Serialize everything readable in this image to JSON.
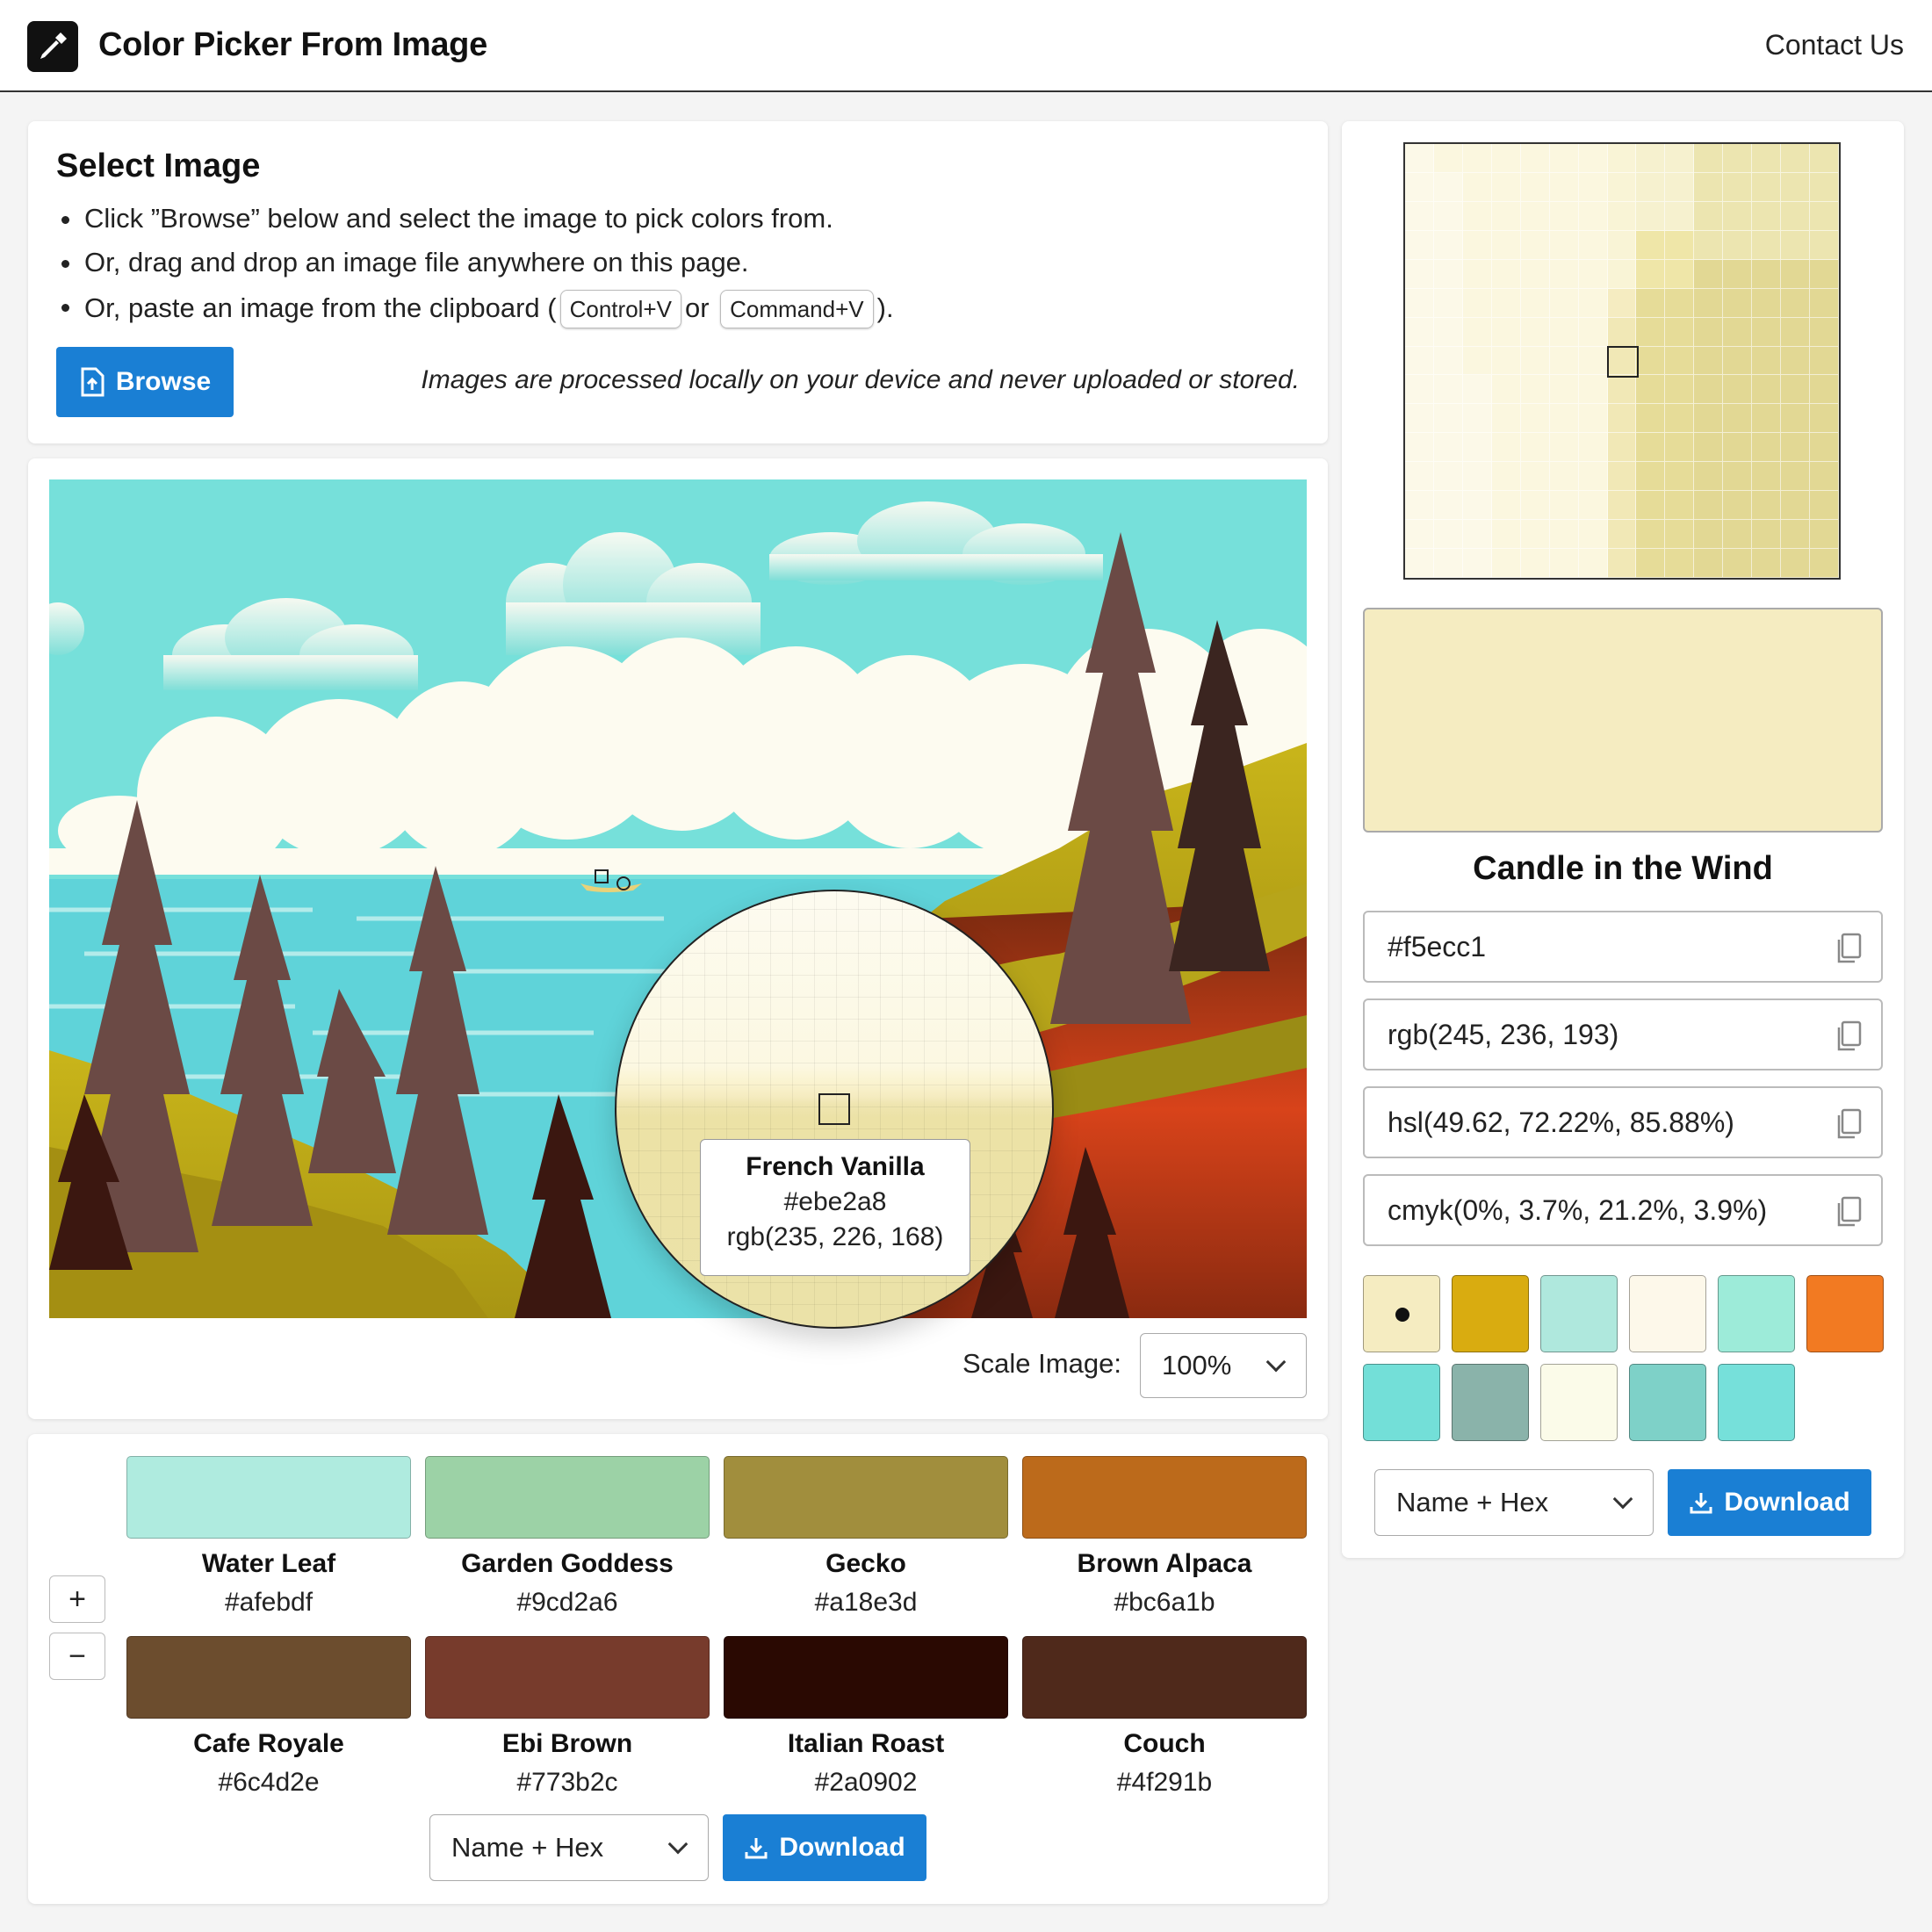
{
  "header": {
    "title": "Color Picker From Image",
    "contact": "Contact Us"
  },
  "select_card": {
    "title": "Select Image",
    "bullet1": "Click ”Browse” below and select the image to pick colors from.",
    "bullet2": "Or, drag and drop an image file anywhere on this page.",
    "bullet3_prefix": "Or, paste an image from the clipboard (",
    "kbd1": "Control+V",
    "bullet3_or": "or",
    "kbd2": "Command+V",
    "bullet3_suffix": ").",
    "browse_label": "Browse",
    "privacy_note": "Images are processed locally on your device and never uploaded or stored."
  },
  "magnifier": {
    "name": "French Vanilla",
    "hex": "#ebe2a8",
    "rgb": "rgb(235, 226, 168)"
  },
  "scale": {
    "label": "Scale Image:",
    "value": "100%"
  },
  "palette": {
    "items": [
      {
        "name": "Water Leaf",
        "hex": "#afebdf"
      },
      {
        "name": "Garden Goddess",
        "hex": "#9cd2a6"
      },
      {
        "name": "Gecko",
        "hex": "#a18e3d"
      },
      {
        "name": "Brown Alpaca",
        "hex": "#bc6a1b"
      },
      {
        "name": "Cafe Royale",
        "hex": "#6c4d2e"
      },
      {
        "name": "Ebi Brown",
        "hex": "#773b2c"
      },
      {
        "name": "Italian Roast",
        "hex": "#2a0902"
      },
      {
        "name": "Couch",
        "hex": "#4f291b"
      }
    ],
    "zoom_in": "+",
    "zoom_out": "−",
    "format_select": "Name + Hex",
    "download_label": "Download"
  },
  "picked": {
    "name": "Candle in the Wind",
    "hex": "#f5ecc1",
    "rgb": "rgb(245, 236, 193)",
    "hsl": "hsl(49.62, 72.22%, 85.88%)",
    "cmyk": "cmyk(0%, 3.7%, 21.2%, 3.9%)",
    "swatch_color": "#f5ecc1"
  },
  "history": {
    "colors": [
      "#f5ecc1",
      "#d9ac10",
      "#afe8dd",
      "#fdf8ea",
      "#9debd9",
      "#f27a22",
      "#73dfd8",
      "#8ab3aa",
      "#fbfbe9",
      "#7ed1c8",
      "#76e0da"
    ],
    "format_select": "Name + Hex",
    "download_label": "Download"
  },
  "colors": {
    "accent": "#1a7fd4"
  }
}
